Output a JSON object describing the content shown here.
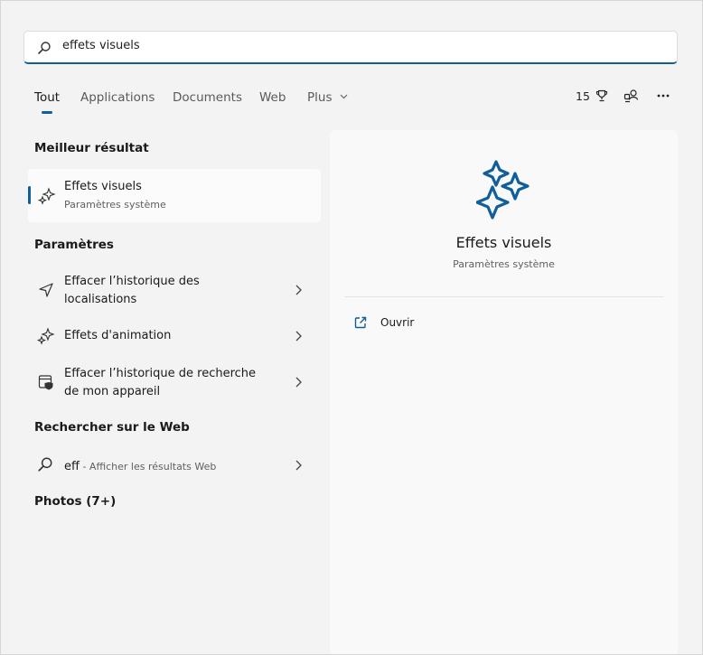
{
  "search": {
    "query": "effets visuels"
  },
  "tabs": [
    "Tout",
    "Applications",
    "Documents",
    "Web",
    "Plus"
  ],
  "top_right": {
    "points": "15"
  },
  "sections": {
    "best": "Meilleur résultat",
    "settings": "Paramètres",
    "web": "Rechercher sur le Web",
    "photos": "Photos (7+)"
  },
  "best_result": {
    "title": "Effets visuels",
    "subtitle": "Paramètres système"
  },
  "settings_items": [
    {
      "line1": "Effacer l’historique des",
      "line2": "localisations"
    },
    {
      "line1": "Effets d'animation"
    },
    {
      "line1": "Effacer l’historique de recherche",
      "line2": "de mon appareil"
    }
  ],
  "web_result": {
    "query": "eff",
    "suffix": " - Afficher les résultats Web"
  },
  "preview": {
    "title": "Effets visuels",
    "subtitle": "Paramètres système",
    "action": "Ouvrir"
  },
  "colors": {
    "accent": "#0f5f9a",
    "icon_blue": "#0f5f9a"
  }
}
